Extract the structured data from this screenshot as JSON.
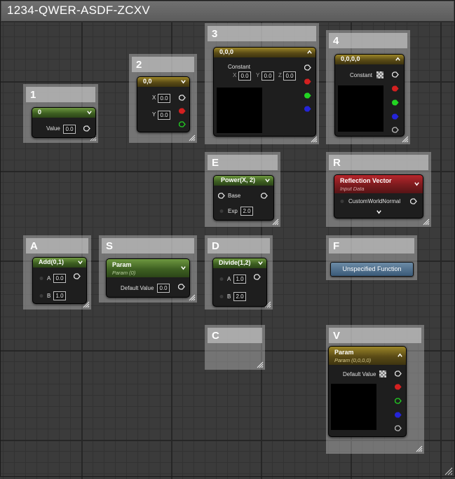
{
  "window": {
    "title": "1234-QWER-ASDF-ZCXV"
  },
  "groups": {
    "g1": {
      "label": "1"
    },
    "g2": {
      "label": "2"
    },
    "g3": {
      "label": "3"
    },
    "g4": {
      "label": "4"
    },
    "gE": {
      "label": "E"
    },
    "gR": {
      "label": "R"
    },
    "gA": {
      "label": "A"
    },
    "gS": {
      "label": "S"
    },
    "gD": {
      "label": "D"
    },
    "gF": {
      "label": "F"
    },
    "gC": {
      "label": "C"
    },
    "gV": {
      "label": "V"
    }
  },
  "nodes": {
    "n1": {
      "title": "0",
      "value_label": "Value",
      "value": "0.0"
    },
    "n2": {
      "title": "0,0",
      "x_label": "X",
      "x_value": "0.0",
      "y_label": "Y",
      "y_value": "0.0"
    },
    "n3": {
      "title": "0,0,0",
      "const_label": "Constant",
      "x_label": "X",
      "x_value": "0.0",
      "y_label": "Y",
      "y_value": "0.0",
      "z_label": "Z",
      "z_value": "0.0"
    },
    "n4": {
      "title": "0,0,0,0",
      "const_label": "Constant"
    },
    "nE": {
      "title": "Power(X, 2)",
      "base_label": "Base",
      "exp_label": "Exp",
      "exp_value": "2.0"
    },
    "nR": {
      "title": "Reflection Vector",
      "subtitle": "Input Data",
      "pin_label": "CustomWorldNormal"
    },
    "nA": {
      "title": "Add(0,1)",
      "a_label": "A",
      "a_value": "0.0",
      "b_label": "B",
      "b_value": "1.0"
    },
    "nS": {
      "title": "Param",
      "subtitle": "Param (0)",
      "default_label": "Default Value",
      "default_value": "0.0"
    },
    "nD": {
      "title": "Divide(1,2)",
      "a_label": "A",
      "a_value": "1.0",
      "b_label": "B",
      "b_value": "2.0"
    },
    "nF": {
      "title": "Unspecified Function"
    },
    "nV": {
      "title": "Param",
      "subtitle": "Param (0,0,0,0)",
      "default_label": "Default Value"
    }
  },
  "colors": {
    "pin_white": "#e6e6e6",
    "pin_red": "#d42020",
    "pin_green": "#22d422",
    "pin_blue": "#2424d8",
    "pin_gray": "#bdbdbd"
  }
}
